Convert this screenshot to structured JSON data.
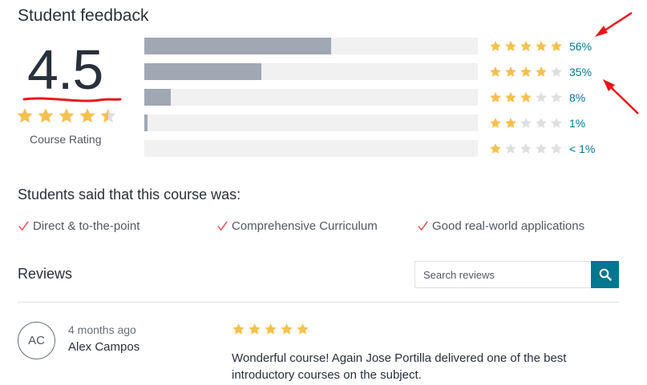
{
  "header": {
    "title": "Student feedback"
  },
  "overall": {
    "rating_value": "4.5",
    "rating_stars": 4.5,
    "label": "Course Rating"
  },
  "distribution": [
    {
      "stars": 5,
      "percent_label": "56%",
      "fill_fraction": 0.56
    },
    {
      "stars": 4,
      "percent_label": "35%",
      "fill_fraction": 0.35
    },
    {
      "stars": 3,
      "percent_label": "8%",
      "fill_fraction": 0.08
    },
    {
      "stars": 2,
      "percent_label": "1%",
      "fill_fraction": 0.01
    },
    {
      "stars": 1,
      "percent_label": "< 1%",
      "fill_fraction": 0.0
    }
  ],
  "said": {
    "title": "Students said that this course was:",
    "items": [
      "Direct & to-the-point",
      "Comprehensive Curriculum",
      "Good real-world applications"
    ]
  },
  "reviews": {
    "title": "Reviews",
    "search_placeholder": "Search reviews",
    "items": [
      {
        "initials": "AC",
        "time": "4 months ago",
        "name": "Alex Campos",
        "stars": 5,
        "text": "Wonderful course! Again Jose Portilla delivered one of the best introductory courses on the subject."
      }
    ]
  },
  "colors": {
    "star_filled": "#f4c150",
    "star_empty": "#dedfe0",
    "bar_fill": "#a1a7b3",
    "bar_track": "#f1f1f1",
    "link": "#007791",
    "check": "#ec5252",
    "annotation": "#e8161c"
  },
  "icons": {
    "star": "star-icon",
    "check": "check-icon",
    "search": "search-icon"
  }
}
